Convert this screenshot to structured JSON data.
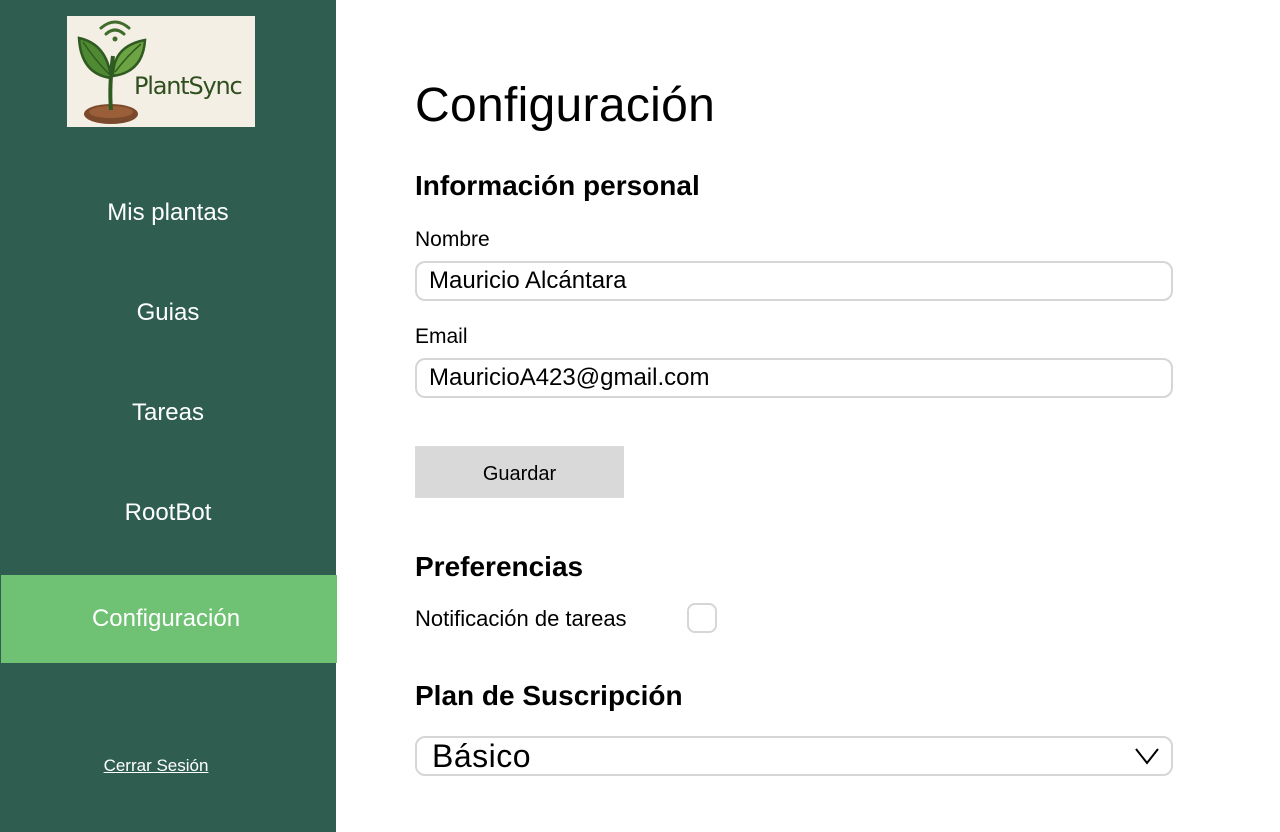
{
  "brand": {
    "logo_text": "PlantSync"
  },
  "sidebar": {
    "items": [
      {
        "label": "Mis plantas"
      },
      {
        "label": "Guias"
      },
      {
        "label": "Tareas"
      },
      {
        "label": "RootBot"
      },
      {
        "label": "Configuración",
        "active": true
      }
    ],
    "logout_label": "Cerrar Sesión"
  },
  "main": {
    "title": "Configuración",
    "personal": {
      "heading": "Información personal",
      "name_label": "Nombre",
      "name_value": "Mauricio Alcántara",
      "email_label": "Email",
      "email_value": "MauricioA423@gmail.com",
      "save_label": "Guardar"
    },
    "preferences": {
      "heading": "Preferencias",
      "task_notification_label": "Notificación de tareas",
      "task_notification_checked": false
    },
    "subscription": {
      "heading": "Plan de Suscripción",
      "selected_plan": "Básico"
    }
  },
  "colors": {
    "sidebar_bg": "#2f5e50",
    "active_item_bg": "#6fc173",
    "button_bg": "#d9d9d9",
    "input_border": "#d6d6d6"
  },
  "icons": {
    "logo": "plant-sprout-wifi-icon",
    "dropdown": "chevron-down-icon"
  }
}
